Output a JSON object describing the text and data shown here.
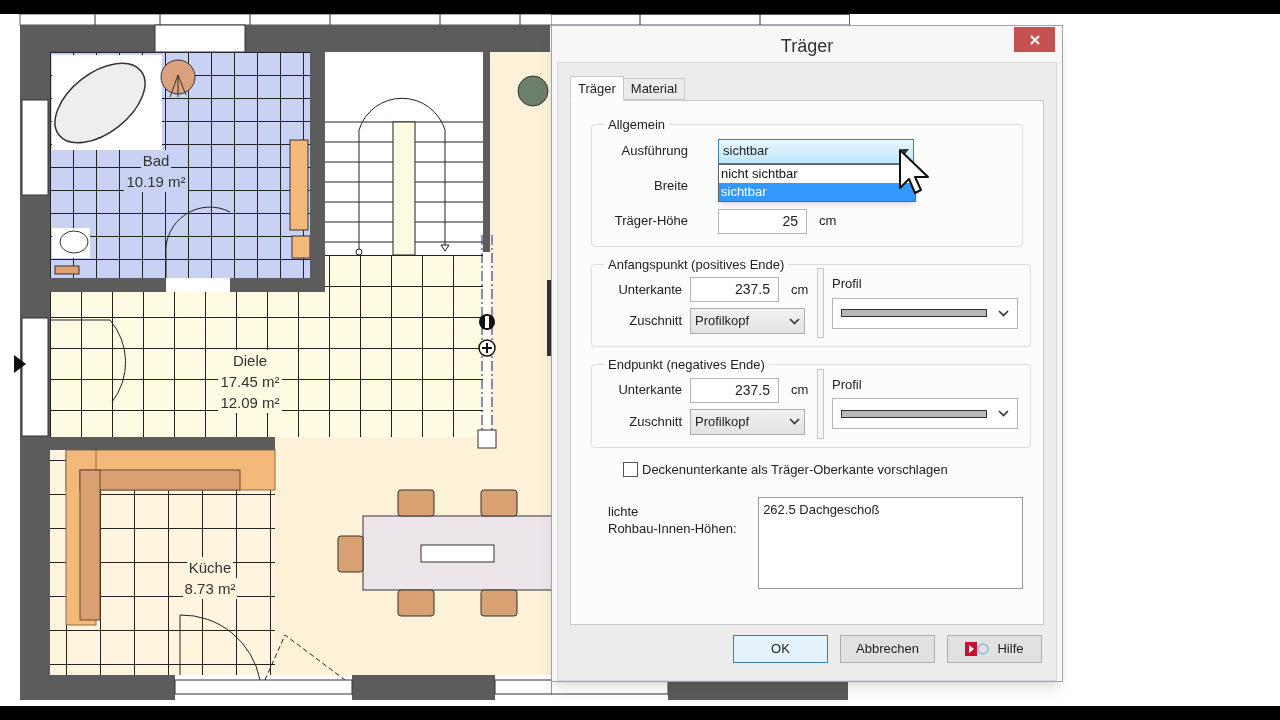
{
  "plan": {
    "rooms": [
      {
        "kind": "bath",
        "name": "Bad",
        "areas": [
          "10.19 m²"
        ]
      },
      {
        "kind": "hall",
        "name": "Diele",
        "areas": [
          "17.45 m²",
          "12.09 m²"
        ]
      },
      {
        "kind": "kitchen",
        "name": "Küche",
        "areas": [
          "8.73 m²"
        ]
      }
    ]
  },
  "dialog": {
    "title": "Träger",
    "tabs": [
      {
        "label": "Träger",
        "selected": true
      },
      {
        "label": "Material",
        "selected": false
      }
    ],
    "general": {
      "title": "Allgemein",
      "execution": {
        "label": "Ausführung",
        "value": "sichtbar",
        "open": true,
        "options": [
          {
            "label": "nicht sichtbar",
            "selected": false
          },
          {
            "label": "sichtbar",
            "selected": true
          }
        ]
      },
      "width_label": "Breite",
      "height": {
        "label": "Träger-Höhe",
        "value": "25",
        "unit": "cm"
      }
    },
    "ends": [
      {
        "title": "Anfangspunkt (positives Ende)",
        "bottom": {
          "label": "Unterkante",
          "value": "237.5",
          "unit": "cm"
        },
        "cut": {
          "label": "Zuschnitt",
          "value": "Profilkopf"
        },
        "profile_label": "Profil"
      },
      {
        "title": "Endpunkt (negatives Ende)",
        "bottom": {
          "label": "Unterkante",
          "value": "237.5",
          "unit": "cm"
        },
        "cut": {
          "label": "Zuschnitt",
          "value": "Profilkopf"
        },
        "profile_label": "Profil"
      }
    ],
    "suggest": {
      "label": "Deckenunterkante als Träger-Oberkante vorschlagen",
      "checked": false
    },
    "heights": {
      "label_lines": [
        "lichte",
        "Rohbau-Innen-Höhen:"
      ],
      "values": [
        "262.5 Dachgeschoß"
      ]
    },
    "buttons": [
      {
        "kind": "default",
        "label": "OK"
      },
      {
        "kind": "plain",
        "label": "Abbrechen"
      },
      {
        "kind": "help",
        "label": "Hilfe"
      }
    ]
  }
}
